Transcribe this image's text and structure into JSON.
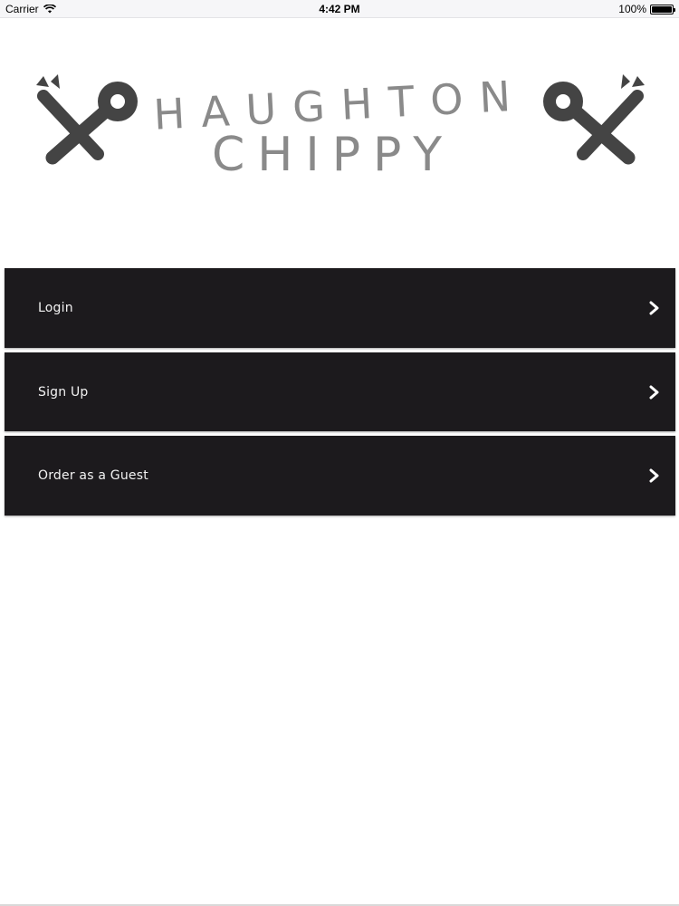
{
  "status_bar": {
    "carrier": "Carrier",
    "time": "4:42 PM",
    "battery_text": "100%",
    "battery_level": 1.0
  },
  "logo": {
    "line1": "HAUGHTON",
    "line2": "CHIPPY",
    "color": "#8a8a8a",
    "icon_color": "#444444"
  },
  "menu": {
    "items": [
      {
        "label": "Login",
        "icon": "chevron-right-icon"
      },
      {
        "label": "Sign Up",
        "icon": "chevron-right-icon"
      },
      {
        "label": "Order as a Guest",
        "icon": "chevron-right-icon"
      }
    ],
    "background": "#1c1a1d",
    "text_color": "#f2f2f2"
  }
}
